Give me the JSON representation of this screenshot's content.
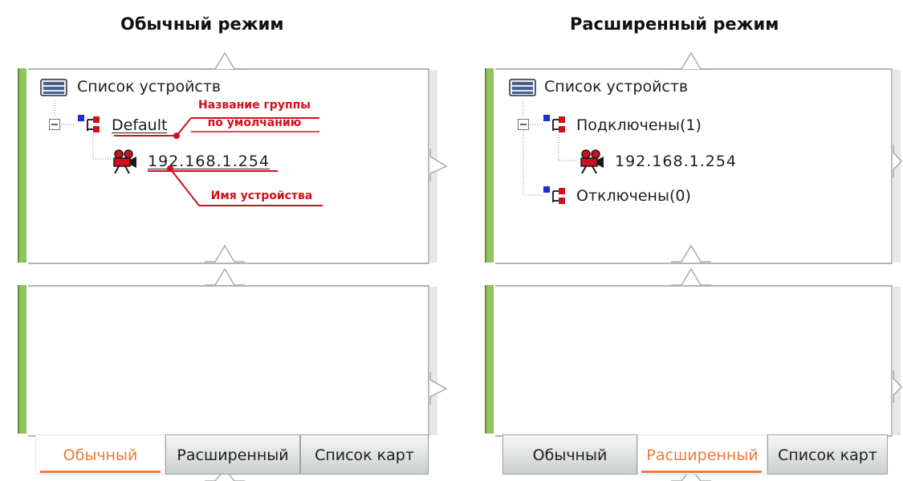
{
  "panels": [
    {
      "title": "Обычный режим",
      "tree": {
        "root_label": "Список устройств",
        "group_label": "Default",
        "device_label": "192.168.1.254",
        "annotations": {
          "group_line1": "Название группы",
          "group_line2": "по умолчанию",
          "device": "Имя устройства"
        }
      },
      "tabs": [
        "Обычный",
        "Расширенный",
        "Список карт"
      ],
      "active_tab": "Обычный"
    },
    {
      "title": "Расширенный режим",
      "tree": {
        "root_label": "Список устройств",
        "group_connected": "Подключены(1)",
        "device_label": "192.168.1.254",
        "group_disconnected": "Отключены(0)"
      },
      "tabs": [
        "Обычный",
        "Расширенный",
        "Список карт"
      ],
      "active_tab": "Расширенный"
    }
  ],
  "colors": {
    "accent_tab": "#ee7a3a",
    "annotation_red": "#d0111b",
    "sidebar_green": "#8fc55d",
    "group_icon_blue": "#1f2fd6",
    "group_icon_red": "#d0111b",
    "device_icon_red": "#d0111b"
  },
  "icons": {
    "root": "device-list-icon",
    "group": "group-icon",
    "device": "camera-icon",
    "expander": "minus-expander-icon"
  }
}
